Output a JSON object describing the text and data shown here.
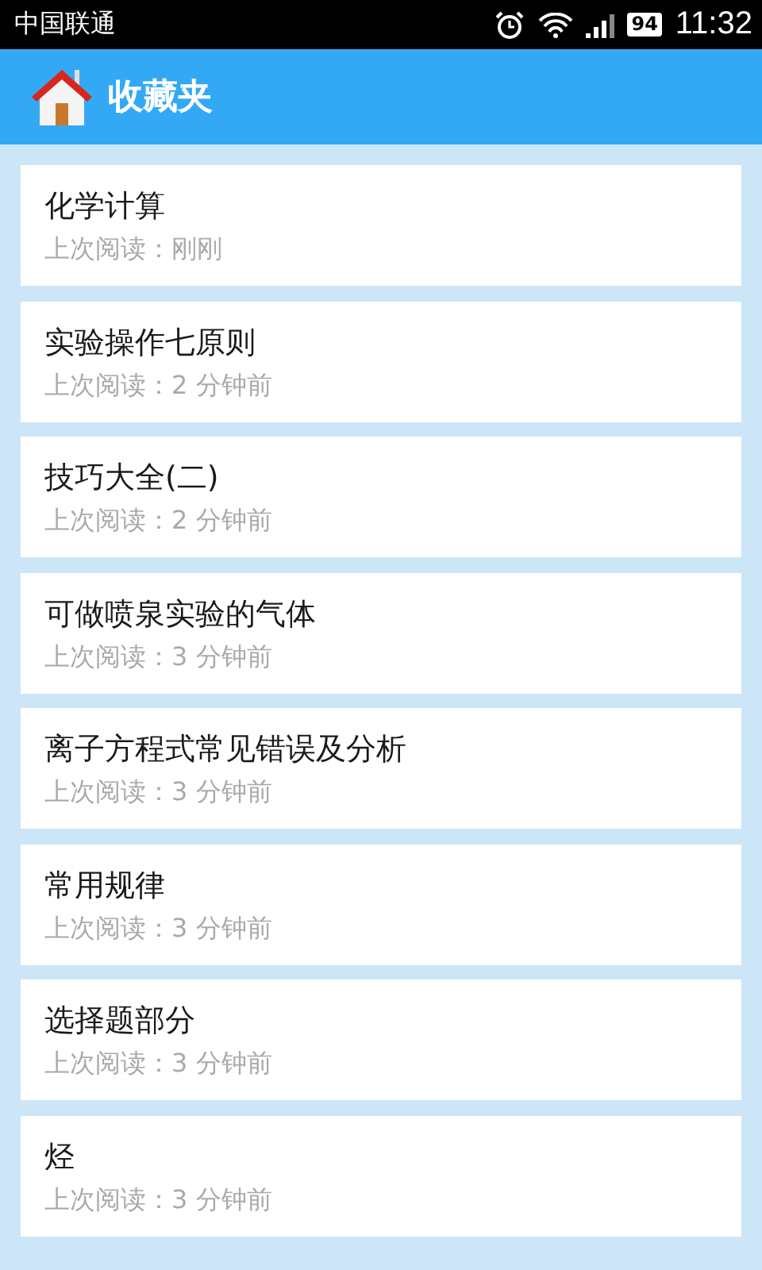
{
  "status_bar": {
    "carrier": "中国联通",
    "battery": "94",
    "time": "11:32"
  },
  "header": {
    "title": "收藏夹"
  },
  "favorites": [
    {
      "title": "化学计算",
      "last_read": "上次阅读：刚刚"
    },
    {
      "title": "实验操作七原则",
      "last_read": "上次阅读：2 分钟前"
    },
    {
      "title": "技巧大全(二)",
      "last_read": "上次阅读：2 分钟前"
    },
    {
      "title": "可做喷泉实验的气体",
      "last_read": "上次阅读：3 分钟前"
    },
    {
      "title": "离子方程式常见错误及分析",
      "last_read": "上次阅读：3 分钟前"
    },
    {
      "title": "常用规律",
      "last_read": "上次阅读：3 分钟前"
    },
    {
      "title": "选择题部分",
      "last_read": "上次阅读：3 分钟前"
    },
    {
      "title": "烃",
      "last_read": "上次阅读：3 分钟前"
    }
  ]
}
